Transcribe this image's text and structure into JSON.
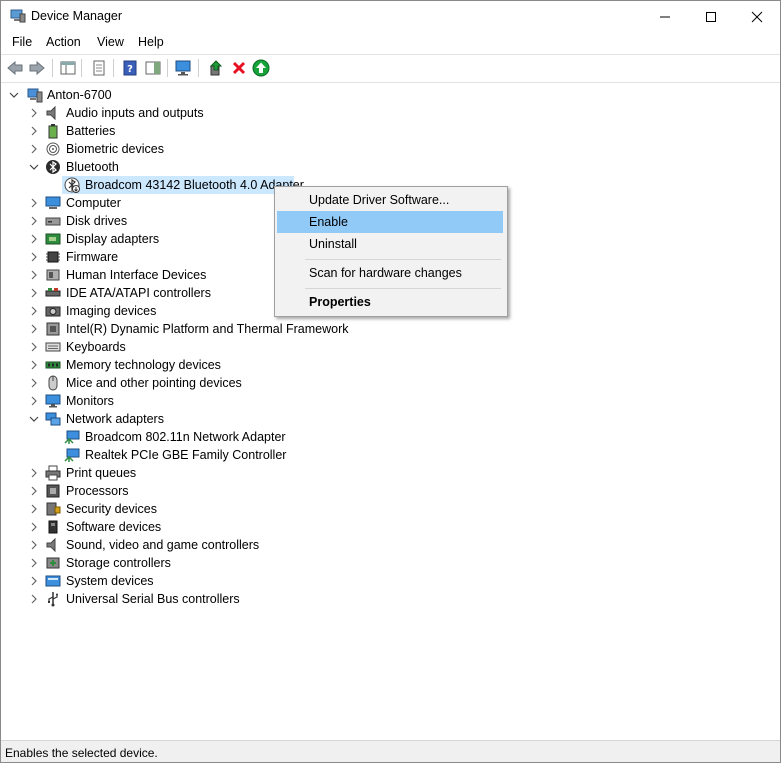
{
  "window": {
    "title": "Device Manager"
  },
  "menu": [
    "File",
    "Action",
    "View",
    "Help"
  ],
  "tree": {
    "root": "Anton-6700",
    "items": [
      {
        "label": "Audio inputs and outputs",
        "icon": "speaker-icon"
      },
      {
        "label": "Batteries",
        "icon": "battery-icon"
      },
      {
        "label": "Biometric devices",
        "icon": "fingerprint-icon"
      },
      {
        "label": "Bluetooth",
        "icon": "bluetooth-icon",
        "expanded": true,
        "children": [
          {
            "label": "Broadcom 43142 Bluetooth 4.0 Adapter",
            "icon": "bluetooth-disabled-icon",
            "selected": true
          }
        ]
      },
      {
        "label": "Computer",
        "icon": "computer-icon"
      },
      {
        "label": "Disk drives",
        "icon": "disk-drive-icon"
      },
      {
        "label": "Display adapters",
        "icon": "display-adapter-icon"
      },
      {
        "label": "Firmware",
        "icon": "chip-icon"
      },
      {
        "label": "Human Interface Devices",
        "icon": "hid-icon"
      },
      {
        "label": "IDE ATA/ATAPI controllers",
        "icon": "ide-icon"
      },
      {
        "label": "Imaging devices",
        "icon": "camera-icon"
      },
      {
        "label": "Intel(R) Dynamic Platform and Thermal Framework",
        "icon": "device-icon"
      },
      {
        "label": "Keyboards",
        "icon": "keyboard-icon"
      },
      {
        "label": "Memory technology devices",
        "icon": "memory-icon"
      },
      {
        "label": "Mice and other pointing devices",
        "icon": "mouse-icon"
      },
      {
        "label": "Monitors",
        "icon": "monitor-icon"
      },
      {
        "label": "Network adapters",
        "icon": "network-icon",
        "expanded": true,
        "children": [
          {
            "label": "Broadcom 802.11n Network Adapter",
            "icon": "network-adapter-icon"
          },
          {
            "label": "Realtek PCIe GBE Family Controller",
            "icon": "network-adapter-icon"
          }
        ]
      },
      {
        "label": "Print queues",
        "icon": "printer-icon"
      },
      {
        "label": "Processors",
        "icon": "processor-icon"
      },
      {
        "label": "Security devices",
        "icon": "security-icon"
      },
      {
        "label": "Software devices",
        "icon": "software-icon"
      },
      {
        "label": "Sound, video and game controllers",
        "icon": "speaker-icon"
      },
      {
        "label": "Storage controllers",
        "icon": "storage-icon"
      },
      {
        "label": "System devices",
        "icon": "system-icon"
      },
      {
        "label": "Universal Serial Bus controllers",
        "icon": "usb-icon"
      }
    ]
  },
  "context_menu": {
    "items": [
      "Update Driver Software...",
      "Enable",
      "Uninstall",
      "Scan for hardware changes",
      "Properties"
    ],
    "highlighted": "Enable"
  },
  "status": "Enables the selected device.",
  "colors": {
    "selection": "#cce8ff",
    "menu_highlight": "#91c9f7",
    "remove": "#e81123",
    "enable": "#16a43a"
  }
}
